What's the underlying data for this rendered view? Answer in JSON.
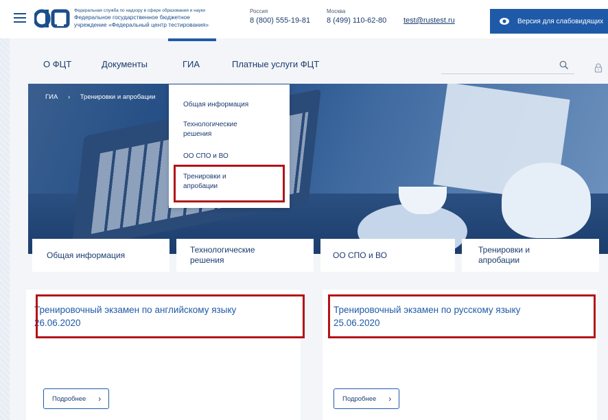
{
  "header": {
    "org_small": "Федеральная служба по надзору в сфере образования и науки",
    "org_line1": "Федеральное государственное бюджетное",
    "org_line2": "учреждение «Федеральный центр тестирования»",
    "russia_label": "Россия",
    "russia_phone": "8 (800) 555-19-81",
    "moscow_label": "Москва",
    "moscow_phone": "8 (499) 110-62-80",
    "email": "test@rustest.ru",
    "vision_button": "Версия для слабовидящих"
  },
  "nav": {
    "items": [
      "О ФЦТ",
      "Документы",
      "ГИА",
      "Платные услуги ФЦТ"
    ],
    "active": "ГИА"
  },
  "breadcrumb": {
    "root": "ГИА",
    "separator": "›",
    "current": "Тренировки и апробации"
  },
  "dropdown": {
    "items": [
      "Общая информация",
      "Технологические решения",
      "ОО СПО и ВО",
      "Тренировки и апробации"
    ],
    "highlighted": "Тренировки и апробации"
  },
  "tabs": [
    "Общая информация",
    "Технологические решения",
    "ОО СПО и ВО",
    "Тренировки и апробации"
  ],
  "cards": [
    {
      "title": "Тренировочный экзамен по английскому языку 26.06.2020",
      "button": "Подробнее"
    },
    {
      "title": "Тренировочный экзамен по русскому языку 25.06.2020",
      "button": "Подробнее"
    }
  ],
  "colors": {
    "brand_blue": "#1f5aa8",
    "text_navy": "#1a3b6e",
    "highlight_red": "#b31217"
  },
  "icons": [
    "menu-icon",
    "logo-icon",
    "eye-icon",
    "search-icon",
    "lock-icon",
    "chevron-right-icon"
  ]
}
